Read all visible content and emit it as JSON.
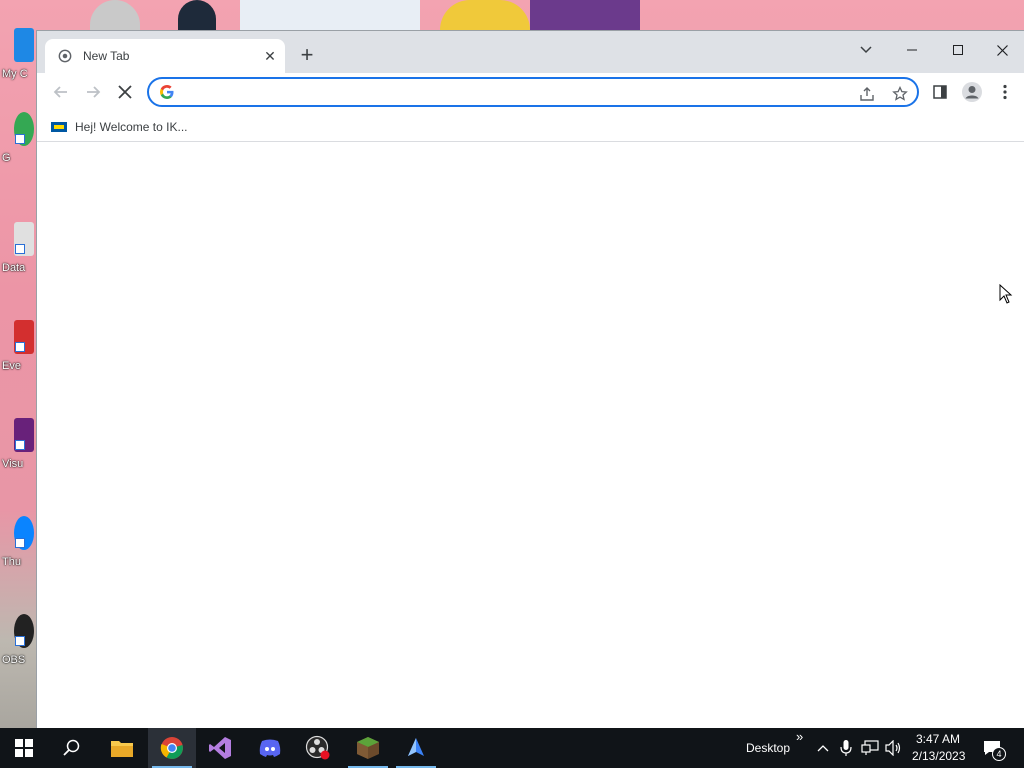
{
  "desktop": {
    "icons": [
      {
        "label": "My C",
        "color": "#1e88e5"
      },
      {
        "label": "G",
        "color": "#34a853"
      },
      {
        "label": "Data",
        "color": "#e0e0e0"
      },
      {
        "label": "Eve",
        "color": "#d32f2f"
      },
      {
        "label": "Visu",
        "color": "#68217a"
      },
      {
        "label": "Thu",
        "color": "#0a84ff"
      },
      {
        "label": "OBS",
        "color": "#222222"
      }
    ]
  },
  "browser": {
    "tab": {
      "title": "New Tab",
      "close_icon": "close-icon"
    },
    "window_controls": {
      "minimize": "minimize-icon",
      "maximize": "maximize-icon",
      "close": "close-icon"
    },
    "omnibox": {
      "value": "",
      "placeholder": ""
    },
    "bookmarks": [
      {
        "label": "Hej! Welcome to IK..."
      }
    ]
  },
  "taskbar": {
    "apps": [
      {
        "name": "file-explorer-icon"
      },
      {
        "name": "chrome-icon",
        "active": true
      },
      {
        "name": "visual-studio-icon"
      },
      {
        "name": "discord-icon"
      },
      {
        "name": "obs-icon"
      },
      {
        "name": "minecraft-icon"
      },
      {
        "name": "app-icon"
      }
    ],
    "desktop_label": "Desktop",
    "overflow": "»",
    "time": "3:47 AM",
    "date": "2/13/2023",
    "notification_count": "4"
  }
}
